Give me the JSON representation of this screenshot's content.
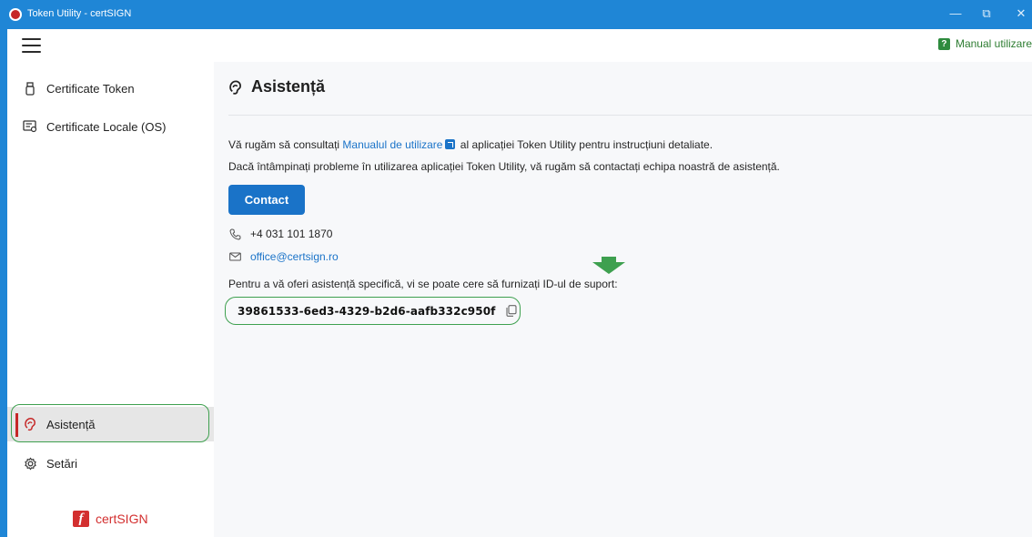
{
  "window": {
    "title": "Token Utility - certSIGN",
    "minimize": "—",
    "restore": "⧉",
    "close": "✕",
    "accent": "#1f86d6"
  },
  "menubar": {
    "help_label": "Manual utilizare",
    "help_icon": "question-icon",
    "help_icon_glyph": "?"
  },
  "sidebar": {
    "items": [
      {
        "label": "Certificate Token",
        "icon": "usb-token-icon"
      },
      {
        "label": "Certificate Locale (OS)",
        "icon": "local-certificate-icon"
      },
      {
        "label": "Asistență",
        "icon": "support-icon",
        "active": true
      },
      {
        "label": "Setări",
        "icon": "gear-icon"
      }
    ],
    "brand": {
      "mark": "f",
      "text": "certSIGN",
      "color": "#d32f2f"
    }
  },
  "main": {
    "title": "Asistență",
    "line1_before": "Vă rugăm să consultați ",
    "line1_link": "Manualul de utilizare",
    "line1_after": " al aplicației Token Utility pentru instrucțiuni detaliate.",
    "line2": "Dacă întâmpinați probleme în utilizarea aplicației Token Utility, vă rugăm să contactați echipa noastră de asistență.",
    "contact_button": "Contact",
    "phone": "+4 031 101 1870",
    "email": "office@certsign.ro",
    "support_id_label": "Pentru a vă oferi asistență specifică, vi se poate cere să furnizați ID-ul de suport:",
    "support_id": "39861533-6ed3-4329-b2d6-aafb332c950f"
  },
  "colors": {
    "primary": "#1a73c8",
    "highlight": "#3ea04f",
    "active_bar": "#c62828"
  }
}
